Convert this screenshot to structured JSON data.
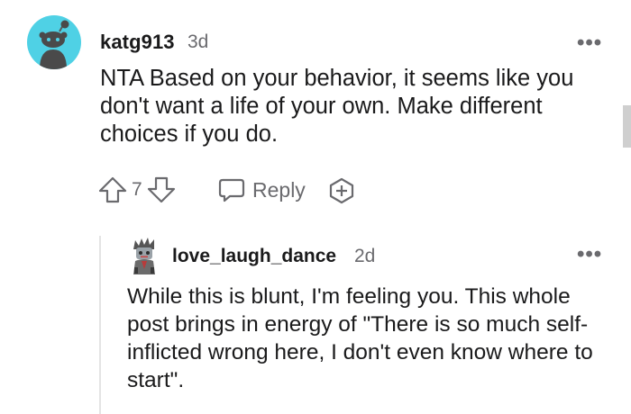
{
  "comment": {
    "username": "katg913",
    "time": "3d",
    "text": "NTA Based on your behavior, it seems like you don't want a life of your own. Make different choices if you do.",
    "votes": "7",
    "reply_label": "Reply",
    "more_label": "•••",
    "avatar_icon": "snoo-avatar-icon"
  },
  "reply": {
    "username": "love_laugh_dance",
    "time": "2d",
    "text": "While this is blunt, I'm feeling you. This whole post brings in energy of \"There is so much self-inflicted wrong here, I don't even know where to start\".",
    "more_label": "•••",
    "avatar_icon": "custom-avatar-icon"
  },
  "colors": {
    "avatar_bg": "#4fd1e5",
    "text": "#1a1a1b",
    "meta": "#6a6a6e"
  }
}
